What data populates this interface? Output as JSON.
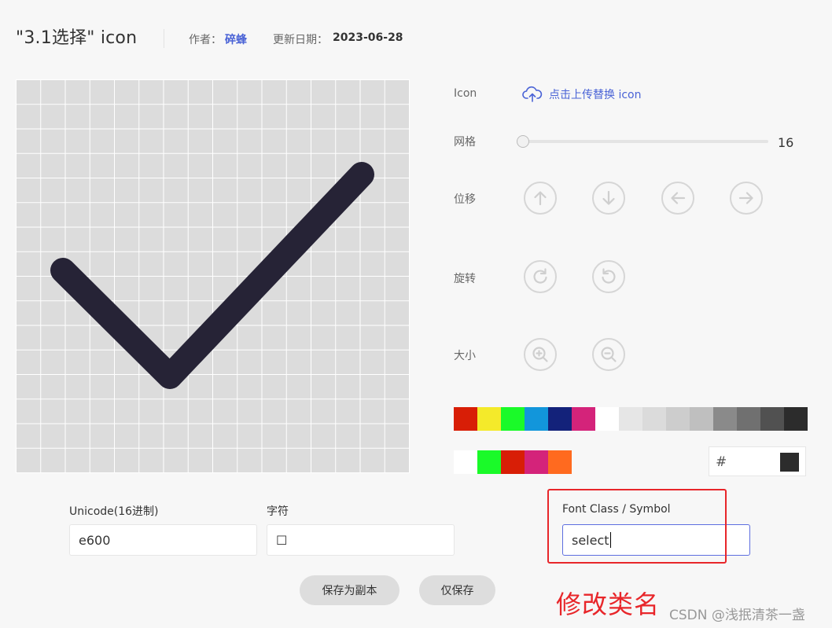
{
  "header": {
    "title": "\"3.1选择\"  icon",
    "author_label": "作者：",
    "author_name": "碎蜂",
    "updated_label": "更新日期：",
    "updated_date": "2023-06-28"
  },
  "editor": {
    "icon_label": "Icon",
    "upload_text": "点击上传替换 icon",
    "grid_label": "网格",
    "grid_value": "16",
    "grid_slider_fraction": 0.0,
    "move_label": "位移",
    "rotate_label": "旋转",
    "size_label": "大小"
  },
  "colors": {
    "palette_row1": [
      "#d81e06",
      "#f4ea2a",
      "#1afa29",
      "#1296db",
      "#13227a",
      "#d4237a",
      "#ffffff",
      "#e6e6e6",
      "#dbdbdb",
      "#cdcdcd",
      "#bfbfbf",
      "#8a8a8a",
      "#707070",
      "#515151",
      "#2c2c2c"
    ],
    "recent_row": [
      "#ffffff",
      "#1afa29",
      "#d81e06",
      "#d4237a",
      "#ff6a1f"
    ],
    "hex_prefix": "#",
    "current_color": "#2c2c2c",
    "glyph_color": "#262336"
  },
  "form": {
    "unicode_label": "Unicode(16进制)",
    "unicode_value": "e600",
    "char_label": "字符",
    "char_value": "☐",
    "class_label": "Font Class / Symbol",
    "class_value": "select"
  },
  "buttons": {
    "save_copy": "保存为副本",
    "save_only": "仅保存"
  },
  "annotation": "修改类名",
  "watermark": "CSDN @浅抿清茶一盏"
}
